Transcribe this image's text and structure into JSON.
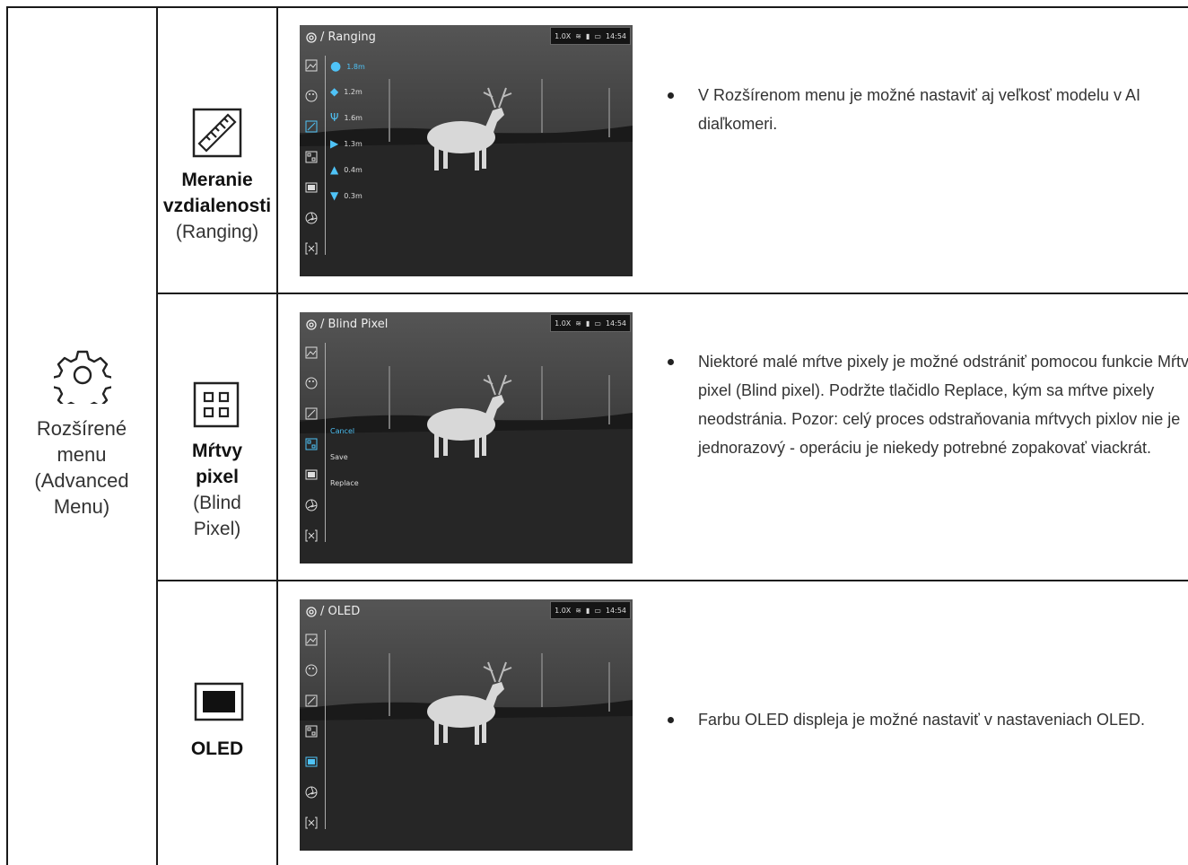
{
  "category": {
    "icon": "gear-icon",
    "label_lines": [
      "Rozšírené",
      "menu",
      "(Advanced",
      "Menu)"
    ]
  },
  "rows": [
    {
      "icon": "ruler-icon",
      "title_bold": [
        "Meranie",
        "vzdialenosti"
      ],
      "title_normal": [
        "(Ranging)"
      ],
      "screen": {
        "header": "/ Ranging",
        "status": {
          "zoom": "1.0X",
          "time": "14:54"
        },
        "menu": [
          {
            "icon": "human-icon",
            "label": "1.8m",
            "active": true
          },
          {
            "icon": "boar-icon",
            "label": "1.2m"
          },
          {
            "icon": "deer-icon",
            "label": "1.6m"
          },
          {
            "icon": "fox-icon",
            "label": "1.3m"
          },
          {
            "icon": "rabbit-icon",
            "label": "0.4m"
          },
          {
            "icon": "bird-icon",
            "label": "0.3m"
          }
        ]
      },
      "description": "V Rozšírenom menu je možné nastaviť aj veľkosť modelu v AI diaľkomeri."
    },
    {
      "icon": "blind-pixel-icon",
      "title_bold": [
        "Mŕtvy",
        "pixel"
      ],
      "title_normal": [
        "(Blind",
        "Pixel)"
      ],
      "screen": {
        "header": "/ Blind Pixel",
        "status": {
          "zoom": "1.0X",
          "time": "14:54"
        },
        "menu": [
          {
            "label": "Cancel",
            "active": true
          },
          {
            "label": "Save"
          },
          {
            "label": "Replace"
          }
        ]
      },
      "description": "Niektoré malé mŕtve pixely je možné odstrániť pomocou funkcie Mŕtvy pixel (Blind pixel). Podržte tlačidlo Replace, kým sa mŕtve pixely neodstránia. Pozor: celý proces odstraňovania mŕtvych pixlov nie je jednorazový - operáciu je niekedy potrebné zopakovať viackrát."
    },
    {
      "icon": "oled-icon",
      "title_bold": [
        "OLED"
      ],
      "title_normal": [],
      "screen": {
        "header": "/ OLED",
        "status": {
          "zoom": "1.0X",
          "time": "14:54"
        },
        "menu": []
      },
      "description": "Farbu OLED displeja je možné nastaviť v nastaveniach OLED."
    }
  ],
  "colors": {
    "accent": "#4fc3f7",
    "border": "#1a1a1a"
  }
}
